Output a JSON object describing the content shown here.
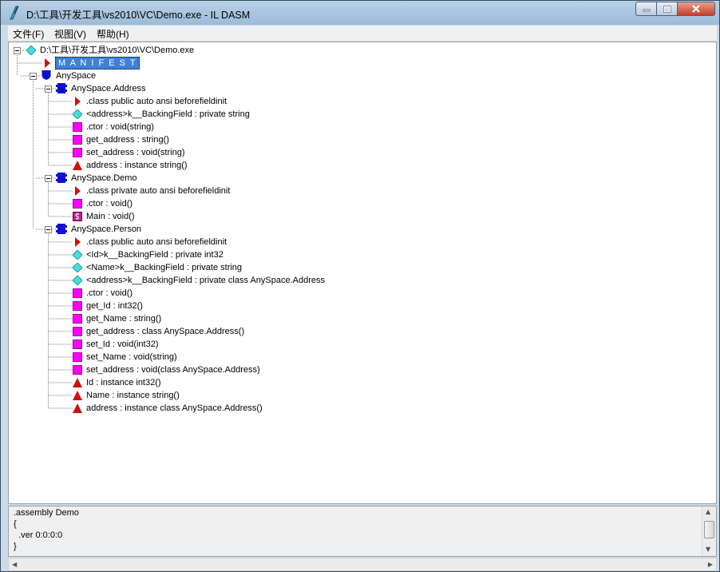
{
  "window": {
    "title": "D:\\工具\\开发工具\\vs2010\\VC\\Demo.exe - IL DASM"
  },
  "menu": {
    "file": "文件(F)",
    "view": "视图(V)",
    "help": "帮助(H)"
  },
  "tree": {
    "root": "D:\\工具\\开发工具\\vs2010\\VC\\Demo.exe",
    "manifest": "M A N I F E S T",
    "namespace": "AnySpace",
    "address_class": {
      "name": "AnySpace.Address",
      "items": [
        ".class public auto ansi beforefieldinit",
        "<address>k__BackingField : private string",
        ".ctor : void(string)",
        "get_address : string()",
        "set_address : void(string)",
        "address : instance string()"
      ]
    },
    "demo_class": {
      "name": "AnySpace.Demo",
      "items": [
        ".class private auto ansi beforefieldinit",
        ".ctor : void()",
        "Main : void()"
      ]
    },
    "person_class": {
      "name": "AnySpace.Person",
      "items": [
        ".class public auto ansi beforefieldinit",
        "<Id>k__BackingField : private int32",
        "<Name>k__BackingField : private string",
        "<address>k__BackingField : private class AnySpace.Address",
        ".ctor : void()",
        "get_Id : int32()",
        "get_Name : string()",
        "get_address : class AnySpace.Address()",
        "set_Id : void(int32)",
        "set_Name : void(string)",
        "set_address : void(class AnySpace.Address)",
        "Id : instance int32()",
        "Name : instance string()",
        "address : instance class AnySpace.Address()"
      ]
    }
  },
  "info": {
    "line1": ".assembly Demo",
    "line2": "{",
    "line3": "  .ver 0:0:0:0",
    "line4": "}"
  }
}
